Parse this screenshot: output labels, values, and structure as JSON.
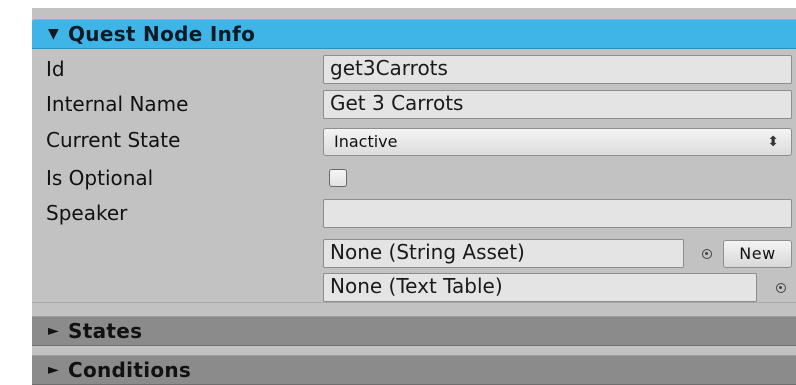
{
  "sections": {
    "quest_node_info": {
      "arrow": "▼",
      "title": "Quest Node Info",
      "expanded": true
    },
    "states": {
      "arrow": "►",
      "title": "States",
      "expanded": false
    },
    "conditions": {
      "arrow": "►",
      "title": "Conditions",
      "expanded": false
    }
  },
  "fields": {
    "id": {
      "label": "Id",
      "value": "get3Carrots"
    },
    "internal_name": {
      "label": "Internal Name",
      "value": "Get 3 Carrots"
    },
    "current_state": {
      "label": "Current State",
      "value": "Inactive",
      "arrow": "⬍"
    },
    "is_optional": {
      "label": "Is Optional",
      "checked": false
    },
    "speaker": {
      "label": "Speaker",
      "value": "",
      "string_asset": "None (String Asset)",
      "new_button": "New",
      "text_table": "None (Text Table)"
    }
  },
  "icons": {
    "section_expanded": "triangle-down-icon",
    "section_collapsed": "triangle-right-icon",
    "object_picker": "object-picker-icon"
  },
  "colors": {
    "active_header": "#3fb4e6",
    "collapsed_header": "#8b8b8b",
    "panel_background": "#c2c2c2",
    "field_background": "#e4e4e4"
  }
}
